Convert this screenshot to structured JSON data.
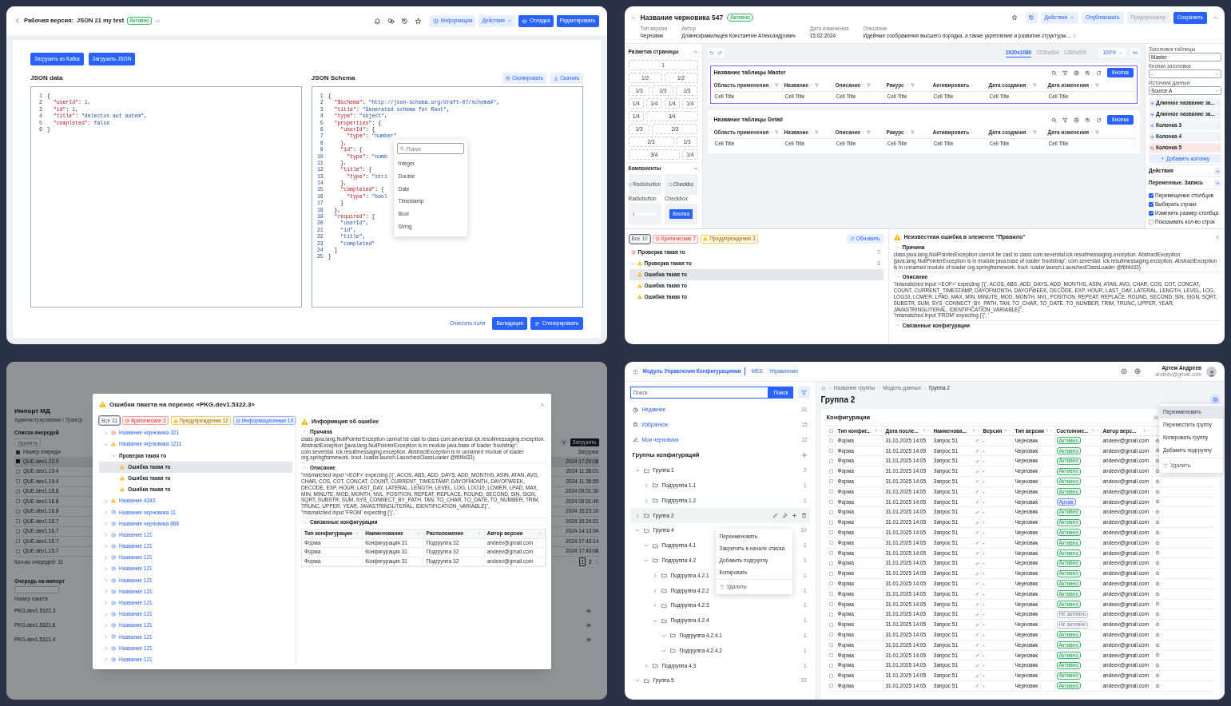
{
  "json_tool": {
    "title_label": "Рабочая версия:",
    "title": "JSON 21 my test",
    "status": {
      "text": "Активно",
      "kind": "active"
    },
    "actions": [
      {
        "label": "Информация",
        "kind": "info"
      },
      {
        "label": "Действия",
        "kind": "menu"
      },
      {
        "label": "Отладка",
        "kind": "debug"
      },
      {
        "label": "Редактировать",
        "kind": "primary"
      }
    ],
    "load_buttons": [
      "Загрузить из Kafka",
      "Загрузить JSON"
    ],
    "data_editor": {
      "title": "JSON data",
      "lines": [
        [
          "1",
          "{"
        ],
        [
          "2",
          "  \"userId\": 1,"
        ],
        [
          "3",
          "  \"id\": 1,"
        ],
        [
          "4",
          "  \"title\": \"delectus aut autem\","
        ],
        [
          "5",
          "  \"completed\": false"
        ],
        [
          "6",
          "}"
        ]
      ]
    },
    "schema_editor": {
      "title": "JSON Schema",
      "copy": "Скопировать",
      "download": "Скачать",
      "lines": [
        [
          "1",
          "{"
        ],
        [
          "2",
          "  \"$schema\": \"http://json-schema.org/draft-07/schema#\","
        ],
        [
          "3",
          "  \"title\": \"Generated schema for Root\","
        ],
        [
          "4",
          "  \"type\": \"object\","
        ],
        [
          "5",
          "  \"properties\": {"
        ],
        [
          "6",
          "    \"userId\": {"
        ],
        [
          "7",
          "      \"type\": \"number\""
        ],
        [
          "8",
          "    },"
        ],
        [
          "9",
          "    \"id\": {"
        ],
        [
          "10",
          "      \"type\": \"numb"
        ],
        [
          "11",
          "    },"
        ],
        [
          "12",
          "    \"title\": {"
        ],
        [
          "13",
          "      \"type\": \"stri"
        ],
        [
          "14",
          "    },"
        ],
        [
          "15",
          "    \"completed\": {"
        ],
        [
          "16",
          "      \"type\": \"bool"
        ],
        [
          "17",
          "    }"
        ],
        [
          "18",
          "  },"
        ],
        [
          "19",
          "  \"required\": ["
        ],
        [
          "20",
          "    \"userId\","
        ],
        [
          "21",
          "    \"id\","
        ],
        [
          "22",
          "    \"title\","
        ],
        [
          "23",
          "    \"completed\""
        ],
        [
          "24",
          "  ]"
        ],
        [
          "25",
          "}"
        ]
      ],
      "dropdown": {
        "placeholder": "Поиск",
        "options": [
          "Integer",
          "Double",
          "Date",
          "Timestamp",
          "Bool",
          "String"
        ]
      }
    },
    "footer": [
      {
        "label": "Очистить поля",
        "kind": "link"
      },
      {
        "label": "Валидация",
        "kind": "primary"
      },
      {
        "label": "Сгенерировать",
        "kind": "generate"
      }
    ]
  },
  "constructor": {
    "title": "Название черновика 547",
    "status": {
      "text": "Активно",
      "kind": "active"
    },
    "actions": [
      {
        "label": "Действия",
        "kind": "menu"
      },
      {
        "label": "Опубликовать",
        "kind": "secondary"
      },
      {
        "label": "Предпросмотр",
        "kind": "disabled"
      },
      {
        "label": "Сохранить",
        "kind": "primary"
      }
    ],
    "meta": [
      {
        "label": "Тип версии",
        "value": "Черновик"
      },
      {
        "label": "Автор",
        "value": "Длиннофамильцев Константин Александрович"
      },
      {
        "label": "Дата изменения",
        "value": "15.02.2024"
      },
      {
        "label": "Описание",
        "value": "Идейные соображения высшего порядка, а также укрепление и развитие структуры..."
      }
    ],
    "layout_panel": {
      "title": "Разметка страницы",
      "options": [
        {
          "label": "1",
          "kind": "full"
        },
        {
          "label": "1/2",
          "kind": "half"
        },
        {
          "label": "1/2",
          "kind": "half"
        },
        {
          "label": "1/3",
          "kind": "third"
        },
        {
          "label": "1/3",
          "kind": "third"
        },
        {
          "label": "1/3",
          "kind": "third"
        },
        {
          "label": "1/4",
          "kind": "quarter"
        },
        {
          "label": "1/4",
          "kind": "quarter"
        },
        {
          "label": "1/4",
          "kind": "quarter"
        },
        {
          "label": "1/4",
          "kind": "quarter"
        },
        {
          "label": "1/4",
          "kind": "quarter"
        },
        {
          "label": "3/4",
          "kind": "three_quarters"
        },
        {
          "label": "1/3",
          "kind": "third"
        },
        {
          "label": "2/3",
          "kind": "two_thirds"
        },
        {
          "label": "2/3",
          "kind": "two_thirds"
        },
        {
          "label": "1/3",
          "kind": "third"
        },
        {
          "label": "3/4",
          "kind": "three_quarters"
        },
        {
          "label": "1/4",
          "kind": "quarter"
        }
      ]
    },
    "components": {
      "title": "Компоненты",
      "items": [
        {
          "kind": "radio",
          "preview": "Radiobutton",
          "label": "Radiobutton"
        },
        {
          "kind": "checkbox",
          "preview": "Checkbo",
          "label": "Checkbox"
        },
        {
          "kind": "input"
        },
        {
          "kind": "button",
          "preview": "Кнопка"
        }
      ]
    },
    "canvas": {
      "resolutions": [
        {
          "label": "1920x1080",
          "selected": true
        },
        {
          "label": "1536x864",
          "selected": false
        },
        {
          "label": "1280x800",
          "selected": false
        }
      ],
      "zoom": "100%"
    },
    "tables": [
      {
        "title": "Название таблицы Master",
        "selected": true,
        "button": "Кнопка",
        "columns": [
          {
            "label": "Область применения",
            "filter": true
          },
          {
            "label": "Название",
            "filter": true
          },
          {
            "label": "Описание",
            "filter": true
          },
          {
            "label": "Ракурс",
            "filter": true
          },
          {
            "label": "Активировать",
            "filter": false
          },
          {
            "label": "Дата создания",
            "filter": true
          },
          {
            "label": "Дата изменения",
            "filter": true
          }
        ],
        "cells": [
          "Cell Title",
          "Cell Title",
          "Cell Title",
          "Cell Title",
          "Cell Title",
          "Cell Title",
          "Cell Title"
        ]
      },
      {
        "title": "Название таблицы Detail",
        "selected": false,
        "button": "Кнопка",
        "columns": [
          {
            "label": "Область применения",
            "filter": true
          },
          {
            "label": "Название",
            "filter": true
          },
          {
            "label": "Описание",
            "filter": true
          },
          {
            "label": "Ракурс",
            "filter": true
          },
          {
            "label": "Активировать",
            "filter": false
          },
          {
            "label": "Дата создания",
            "filter": true
          },
          {
            "label": "Дата изменения",
            "filter": true
          }
        ],
        "cells": [
          "Cell Title",
          "Cell Title",
          "Cell Title",
          "Cell Title",
          "Cell Title",
          "Cell Title",
          "Cell Title"
        ]
      }
    ],
    "properties": {
      "table_title_label": "Заголовок таблицы",
      "table_title": "Master",
      "header_buttons_label": "Кнопки заголовка",
      "header_buttons": "-",
      "source_label": "Источник данных",
      "source": "Source A",
      "columns": [
        {
          "label": "Длинное название за...",
          "visible": true
        },
        {
          "label": "Длинное название за...",
          "visible": true
        },
        {
          "label": "Колонка 3",
          "visible": true
        },
        {
          "label": "Колонка 4",
          "visible": true
        },
        {
          "label": "Колонка 5",
          "visible": false
        }
      ],
      "add_column": "Добавить колонку",
      "sections": [
        "Действия",
        "Переменные. Запись"
      ],
      "options": [
        {
          "label": "Перемещение столбцов",
          "checked": true
        },
        {
          "label": "Выбирать строки",
          "checked": true
        },
        {
          "label": "Изменять размер столбца",
          "checked": true
        },
        {
          "label": "Показывать кол-во строк",
          "checked": false
        }
      ]
    },
    "problems": {
      "filters": [
        {
          "label": "Все 10",
          "kind": "all",
          "selected": true
        },
        {
          "label": "Критические 7",
          "kind": "critical",
          "selected": false
        },
        {
          "label": "Предупреждения 3",
          "kind": "warning",
          "selected": false
        }
      ],
      "refresh": "Обновить",
      "tree": [
        {
          "label": "Проверка такая то",
          "kind": "critical",
          "count": "7",
          "selected": false
        },
        {
          "label": "Проверка такая то",
          "kind": "warning",
          "count": "3",
          "expanded": true,
          "selected": false,
          "children": [
            {
              "label": "Ошибка такая то",
              "kind": "warning",
              "selected": true
            },
            {
              "label": "Ошибка такая то",
              "kind": "warning",
              "selected": false
            },
            {
              "label": "Ошибка такая то",
              "kind": "warning",
              "selected": false
            }
          ]
        }
      ],
      "detail": {
        "title": "Неизвестная ошибка в элементе \"Правило\"",
        "sections": [
          {
            "title": "Причина",
            "paragraphs": [
              "class java.lang.NullPointerException cannot be cast to class com.severstal.ick.resultmessaging.exception. AbstractException (java.lang.NullPointerException is in module java.base of loader 'bootstrap'; com.severstal. ick.resultmessaging.exception. AbstractException is in unnamed module of loader org.springframework. boot. loader.launch.LaunchedClassLoader @f6f4d33)"
            ]
          },
          {
            "title": "Описание",
            "paragraphs": [
              "\"mismatched input '<EOF>' expecting {'(', ACOS, ABS, ADD_DAYS, ADD_MONTHS, ASIN, ATAN, AVG, CHAR, COS, COT, CONCAT, COUNT, CURRENT_TIMESTAMP, DAYOFMONTH, DAYOFWEEK, DECODE, EXP, HOUR, LAST_DAY, LATERAL, LENGTH, LEVEL, LOG, LOG10, LOWER, LPAD, MAX, MIN, MINUTE, MOD, MONTH, NVL, POSITION, REPEAT, REPLACE, ROUND, SECOND, SIN, SIGN, SQRT, SUBSTR, SUM, SYS_CONNECT_BY_PATH, TAN, TO_CHAR, TO_DATE, TO_NUMBER, TRIM, TRUNC, UPPER, YEAR, JAVASTRINGLITERAL, IDENTIFICATION_VARIABLE}\",",
              "\"mismatched input 'FROM' expecting {'(', '"
            ]
          },
          {
            "title": "Связанные конфигурации"
          }
        ]
      }
    }
  },
  "errors_screen": {
    "background": {
      "title": "Импорт МД",
      "breadcrumb": "Администрирование / Трансф",
      "queues_title": "Список очередей",
      "delete": "Удалить",
      "upload": "Загрузить",
      "header_checked": true,
      "queue_column": "Номер очереди",
      "date_column": "Загрузки",
      "rows": [
        {
          "id": "QUE.dev1.22.0",
          "date": "2024 17:29:08",
          "checked": true
        },
        {
          "id": "QUE.dev1.19.4",
          "date": "2024 11:38:01",
          "checked": false
        },
        {
          "id": "QUE.dev1.19.4",
          "date": "2024 11:35:55",
          "checked": false
        },
        {
          "id": "QUE.dev1.18.8",
          "date": "2024 09:01:30",
          "checked": false
        },
        {
          "id": "QUE.dev1.16.8",
          "date": "2024 09:01:40",
          "checked": false
        },
        {
          "id": "QUE.dev1.16.8",
          "date": "2024 15:23:10",
          "checked": false
        },
        {
          "id": "QUE.dev1.16.7",
          "date": "2024 15:24:21",
          "checked": false
        },
        {
          "id": "QUE.dev1.16.7",
          "date": "2024 14:13:04",
          "checked": false
        },
        {
          "id": "QUE.dev1.15.7",
          "date": "2024 17:43:14",
          "checked": false
        },
        {
          "id": "QUE.dev1.15.7",
          "date": "2024 17:43:08",
          "checked": false
        }
      ],
      "count": "Кол-во очередей: 11",
      "pages": [
        {
          "label": "1",
          "selected": true
        },
        {
          "label": "2",
          "selected": false
        }
      ],
      "import_title": "Очередь на импорт",
      "package_column": "Номер пакета",
      "packages": [
        "PKG.dev1.5322.3",
        "PKG.dev1.5321.6",
        "PKG.dev1.5321.4"
      ]
    },
    "modal": {
      "title": "Ошибки пакета на перенос «PKG.dev1.5322.3»",
      "filters": [
        {
          "label": "Все 31",
          "kind": "all",
          "selected": true
        },
        {
          "label": "Критические 3",
          "kind": "critical",
          "selected": false
        },
        {
          "label": "Предупреждения 12",
          "kind": "warning",
          "selected": false
        },
        {
          "label": "Информационные 19",
          "kind": "info",
          "selected": false
        }
      ],
      "tree": [
        {
          "label": "Название черновика 321",
          "kind": "critical",
          "expanded": false,
          "selected": false
        },
        {
          "label": "Название черновика 1211",
          "kind": "warning",
          "expanded": true,
          "selected": false,
          "children": [
            {
              "label": "Проверка такая то",
              "expanded": true,
              "selected": false,
              "children": [
                {
                  "label": "Ошибка такая то",
                  "kind": "warning",
                  "selected": true
                },
                {
                  "label": "Ошибка такая то",
                  "kind": "warning",
                  "selected": false
                },
                {
                  "label": "Ошибка такая то",
                  "kind": "warning",
                  "selected": false
                }
              ]
            }
          ]
        },
        {
          "label": "Название 4343",
          "kind": "warning",
          "expanded": false,
          "selected": false
        },
        {
          "label": "Название черновика 11",
          "kind": "info",
          "expanded": false,
          "selected": false
        },
        {
          "label": "Название черновика 888",
          "kind": "info",
          "expanded": false,
          "selected": false
        },
        {
          "label": "Название 121",
          "kind": "info",
          "expanded": false,
          "selected": false
        },
        {
          "label": "Название 121",
          "kind": "info",
          "expanded": false,
          "selected": false
        },
        {
          "label": "Название 121",
          "kind": "info",
          "expanded": false,
          "selected": false
        },
        {
          "label": "Название 121",
          "kind": "info",
          "expanded": false,
          "selected": false
        },
        {
          "label": "Название 121",
          "kind": "info",
          "expanded": false,
          "selected": false
        },
        {
          "label": "Название 121",
          "kind": "info",
          "expanded": false,
          "selected": false
        },
        {
          "label": "Название 121",
          "kind": "info",
          "expanded": false,
          "selected": false
        },
        {
          "label": "Название 121",
          "kind": "info",
          "expanded": false,
          "selected": false
        },
        {
          "label": "Название 121",
          "kind": "info",
          "expanded": false,
          "selected": false
        },
        {
          "label": "Название 121",
          "kind": "info",
          "expanded": false,
          "selected": false
        },
        {
          "label": "Название 121",
          "kind": "info",
          "expanded": false,
          "selected": false
        },
        {
          "label": "Название 121",
          "kind": "info",
          "expanded": false,
          "selected": false
        }
      ],
      "detail": {
        "title": "Информация об ошибке",
        "sections": [
          {
            "title": "Причина",
            "paragraphs": [
              "class java.lang.NullPointerException cannot be cast to class com.severstal.ick.resultmessaging.exception. AbstractException (java.lang.NullPointerException is in module java.base of loader 'bootstrap'; com.severstal. ick.resultmessaging.exception. AbstractException is in unnamed module of loader org.springframework. boot. loader.launch.LaunchedClassLoader @f6f4d33)"
            ]
          },
          {
            "title": "Описание",
            "paragraphs": [
              "\"mismatched input '<EOF>' expecting {'(', ACOS, ABS, ADD_DAYS, ADD_MONTHS, ASIN, ATAN, AVG, CHAR, COS, COT, CONCAT, COUNT, CURRENT_TIMESTAMP, DAYOFMONTH, DAYOFWEEK, DECODE, EXP, HOUR, LAST_DAY, LATERAL, LENGTH, LEVEL, LOG, LOG10, LOWER, LPAD, MAX, MIN, MINUTE, MOD, MONTH, NVL, POSITION, REPEAT, REPLACE, ROUND, SECOND, SIN, SIGN, SQRT, SUBSTR, SUM, SYS_CONNECT_BY_PATH, TAN, TO_CHAR, TO_DATE, TO_NUMBER, TRIM, TRUNC, UPPER, YEAR, JAVASTRINGLITERAL, IDENTIFICATION_VARIABLE}\",",
              "\"mismatched input 'FROM' expecting {'(', '"
            ]
          },
          {
            "title": "Связанные конфигурации",
            "table": {
              "columns": [
                "Тип конфигурации",
                "Наименование",
                "Расположение",
                "Автор версии"
              ],
              "rows": [
                [
                  "Форма",
                  "Конфигурация 31",
                  "Подгруппа 32",
                  "andeev@gmail.com"
                ],
                [
                  "Форма",
                  "Конфигурация 31",
                  "Подгруппа 32",
                  "andeev@gmail.com"
                ],
                [
                  "Форма",
                  "Конфигурация 31",
                  "Подгруппа 32",
                  "andeev@gmail.com"
                ]
              ]
            }
          }
        ]
      }
    }
  },
  "config_module": {
    "brand": "Модуль Управления Конфигурациями",
    "nav": [
      "MES",
      "Управление"
    ],
    "user": {
      "name": "Артем Андреев",
      "email": "andeev@gmail.com"
    },
    "search": {
      "placeholder": "Поиск",
      "button": "Поиск"
    },
    "quick": [
      {
        "label": "Недавние",
        "count": "31",
        "kind": "recent"
      },
      {
        "label": "Избранное",
        "count": "15",
        "kind": "favorites"
      },
      {
        "label": "Мои черновики",
        "count": "12",
        "kind": "drafts"
      }
    ],
    "groups_title": "Группы конфигураций",
    "tree": [
      {
        "label": "Группа 1",
        "count": "2",
        "expanded": true,
        "hovered": false,
        "children": [
          {
            "label": "Подгруппа 1.1",
            "count": "1",
            "expanded": false,
            "hovered": false
          },
          {
            "label": "Подгруппа 1.2",
            "count": "1",
            "expanded": false,
            "hovered": false
          }
        ]
      },
      {
        "label": "Группа 2",
        "expanded": false,
        "hovered": true
      },
      {
        "label": "Группа 4",
        "count": "10",
        "expanded": true,
        "hovered": false,
        "children": [
          {
            "label": "Подгруппа 4.1",
            "count": "1",
            "expanded": true,
            "hovered": false
          },
          {
            "label": "Подгруппа 4.2",
            "count": "1",
            "expanded": true,
            "hovered": false,
            "children": [
              {
                "label": "Подгруппа 4.2.1",
                "count": "1",
                "expanded": false,
                "hovered": false
              },
              {
                "label": "Подгруппа 4.2.2",
                "count": "1",
                "expanded": false,
                "hovered": false
              },
              {
                "label": "Подгруппа 4.2.3",
                "count": "1",
                "expanded": false,
                "hovered": false
              },
              {
                "label": "Подгруппа 4.2.4",
                "count": "1",
                "expanded": true,
                "hovered": false,
                "children": [
                  {
                    "label": "Подгруппа 4.2.4.1",
                    "count": "1",
                    "expanded": true,
                    "hovered": false
                  },
                  {
                    "label": "Подгруппа 4.2.4.2",
                    "count": "1",
                    "expanded": true,
                    "hovered": false
                  }
                ]
              }
            ]
          },
          {
            "label": "Подгруппа 4.3",
            "count": "1",
            "expanded": false,
            "hovered": false
          }
        ]
      },
      {
        "label": "Группа 5",
        "count": "10",
        "expanded": true,
        "hovered": false
      }
    ],
    "context_menu": [
      {
        "label": "Переименовать",
        "kind": "item"
      },
      {
        "label": "Закрепить в начале списка",
        "kind": "item"
      },
      {
        "label": "Добавить подгруппу",
        "kind": "item"
      },
      {
        "label": "Копировать",
        "kind": "item"
      },
      {
        "label": "Удалить",
        "kind": "delete"
      }
    ],
    "breadcrumbs": [
      "Название группы",
      "Модель данных",
      "Группа 2"
    ],
    "title": "Группа 2",
    "settings_menu": [
      {
        "label": "Переименовать",
        "kind": "item",
        "hovered": true
      },
      {
        "label": "Переместить группу",
        "kind": "item",
        "hovered": false
      },
      {
        "label": "Копировать группу",
        "kind": "item",
        "hovered": false
      },
      {
        "label": "Добавить подгруппу",
        "kind": "item",
        "hovered": false
      },
      {
        "label": "Удалить",
        "kind": "delete",
        "hovered": false
      }
    ],
    "card_title": "Конфигурации",
    "all_checked": false,
    "columns": [
      "Тип конфиг...",
      "Дата после...",
      "Наименова...",
      "Версия",
      "Тип версии",
      "Состояние...",
      "Автор верс..."
    ],
    "rows": [
      {
        "checked": false,
        "cells": [
          "Форма",
          "31.01.2025 14:05",
          "Запрос 51",
          "-",
          "Черновик",
          {
            "text": "Активно",
            "kind": "active"
          },
          "andeev@gmail.com"
        ]
      },
      {
        "checked": false,
        "cells": [
          "Форма",
          "31.01.2025 14:05",
          "Запрос 51",
          "-",
          "Черновик",
          {
            "text": "Активно",
            "kind": "active"
          },
          "andeev@gmail.com"
        ]
      },
      {
        "checked": false,
        "cells": [
          "Форма",
          "31.01.2025 14:05",
          "Запрос 51",
          "-",
          "Черновик",
          {
            "text": "Активно",
            "kind": "active"
          },
          "andeev@gmail.com"
        ]
      },
      {
        "checked": false,
        "cells": [
          "Форма",
          "31.01.2025 14:05",
          "Запрос 51",
          "-",
          "Черновик",
          {
            "text": "Активно",
            "kind": "active"
          },
          "andeev@gmail.com"
        ]
      },
      {
        "checked": false,
        "cells": [
          "Форма",
          "31.01.2025 14:05",
          "Запрос 51",
          "-",
          "Черновик",
          {
            "text": "Активно",
            "kind": "active"
          },
          "andeev@gmail.com"
        ]
      },
      {
        "checked": false,
        "cells": [
          "Форма",
          "31.01.2025 14:05",
          "Запрос 51",
          "-",
          "Черновик",
          {
            "text": "Активно",
            "kind": "active"
          },
          "andeev@gmail.com"
        ]
      },
      {
        "checked": false,
        "cells": [
          "Форма",
          "31.01.2025 14:05",
          "Запрос 51",
          "-",
          "Черновик",
          {
            "text": "Архив",
            "kind": "archive"
          },
          "andeev@gmail.com"
        ]
      },
      {
        "checked": false,
        "cells": [
          "Форма",
          "31.01.2025 14:05",
          "Запрос 51",
          "-",
          "Черновик",
          {
            "text": "Активно",
            "kind": "active"
          },
          "andeev@gmail.com"
        ]
      },
      {
        "checked": false,
        "cells": [
          "Форма",
          "31.01.2025 14:05",
          "Запрос 51",
          "-",
          "Черновик",
          {
            "text": "Активно",
            "kind": "active"
          },
          "andeev@gmail.com"
        ]
      },
      {
        "checked": false,
        "cells": [
          "Форма",
          "31.01.2025 14:05",
          "Запрос 51",
          "-",
          "Черновик",
          {
            "text": "Активно",
            "kind": "active"
          },
          "andeev@gmail.com"
        ]
      },
      {
        "checked": false,
        "cells": [
          "Форма",
          "31.01.2025 14:05",
          "Запрос 51",
          "-",
          "Черновик",
          {
            "text": "Активно",
            "kind": "active"
          },
          "andeev@gmail.com"
        ]
      },
      {
        "checked": false,
        "cells": [
          "Форма",
          "31.01.2025 14:05",
          "Запрос 51",
          "-",
          "Черновик",
          {
            "text": "Активно",
            "kind": "active"
          },
          "andeev@gmail.com"
        ]
      },
      {
        "checked": false,
        "cells": [
          "Форма",
          "31.01.2025 14:05",
          "Запрос 51",
          "-",
          "Черновик",
          {
            "text": "Активно",
            "kind": "active"
          },
          "andeev@gmail.com"
        ]
      },
      {
        "checked": false,
        "cells": [
          "Форма",
          "31.01.2025 14:05",
          "Запрос 51",
          "-",
          "Черновик",
          {
            "text": "Активно",
            "kind": "active"
          },
          "andeev@gmail.com"
        ]
      },
      {
        "checked": false,
        "cells": [
          "Форма",
          "31.01.2025 14:05",
          "Запрос 51",
          "-",
          "Черновик",
          {
            "text": "Активно",
            "kind": "active"
          },
          "andeev@gmail.com"
        ]
      },
      {
        "checked": false,
        "cells": [
          "Форма",
          "31.01.2025 14:05",
          "Запрос 51",
          "-",
          "Черновик",
          {
            "text": "Активно",
            "kind": "active"
          },
          "andeev@gmail.com"
        ]
      },
      {
        "checked": false,
        "cells": [
          "Форма",
          "31.01.2025 14:05",
          "Запрос 51",
          "-",
          "Черновик",
          {
            "text": "Активно",
            "kind": "active"
          },
          "andeev@gmail.com"
        ]
      },
      {
        "checked": false,
        "cells": [
          "Форма",
          "31.01.2025 14:05",
          "Запрос 51",
          "-",
          "Черновик",
          {
            "text": "Не активно",
            "kind": "inactive"
          },
          "andeev@gmail.com"
        ]
      },
      {
        "checked": false,
        "cells": [
          "Форма",
          "31.01.2025 14:05",
          "Запрос 51",
          "-",
          "Черновик",
          {
            "text": "Не активно",
            "kind": "inactive"
          },
          "andeev@gmail.com"
        ]
      },
      {
        "checked": false,
        "cells": [
          "Форма",
          "31.01.2025 14:05",
          "Запрос 51",
          "-",
          "Черновик",
          {
            "text": "Активно",
            "kind": "active"
          },
          "andeev@gmail.com"
        ]
      },
      {
        "checked": false,
        "cells": [
          "Форма",
          "31.01.2025 14:05",
          "Запрос 51",
          "-",
          "Черновик",
          {
            "text": "Активно",
            "kind": "active"
          },
          "andeev@gmail.com"
        ]
      },
      {
        "checked": false,
        "cells": [
          "Форма",
          "31.01.2025 14:05",
          "Запрос 51",
          "-",
          "Черновик",
          {
            "text": "Активно",
            "kind": "active"
          },
          "andeev@gmail.com"
        ]
      },
      {
        "checked": false,
        "cells": [
          "Форма",
          "31.01.2025 14:05",
          "Запрос 51",
          "-",
          "Черновик",
          {
            "text": "Активно",
            "kind": "active"
          },
          "andeev@gmail.com"
        ]
      },
      {
        "checked": false,
        "cells": [
          "Форма",
          "31.01.2025 14:05",
          "Запрос 51",
          "-",
          "Черновик",
          {
            "text": "Активно",
            "kind": "active"
          },
          "andeev@gmail.com"
        ]
      },
      {
        "checked": false,
        "cells": [
          "Форма",
          "31.01.2025 14:05",
          "Запрос 51",
          "-",
          "Черновик",
          {
            "text": "Активно",
            "kind": "active"
          },
          "andeev@gmail.com"
        ]
      }
    ]
  }
}
